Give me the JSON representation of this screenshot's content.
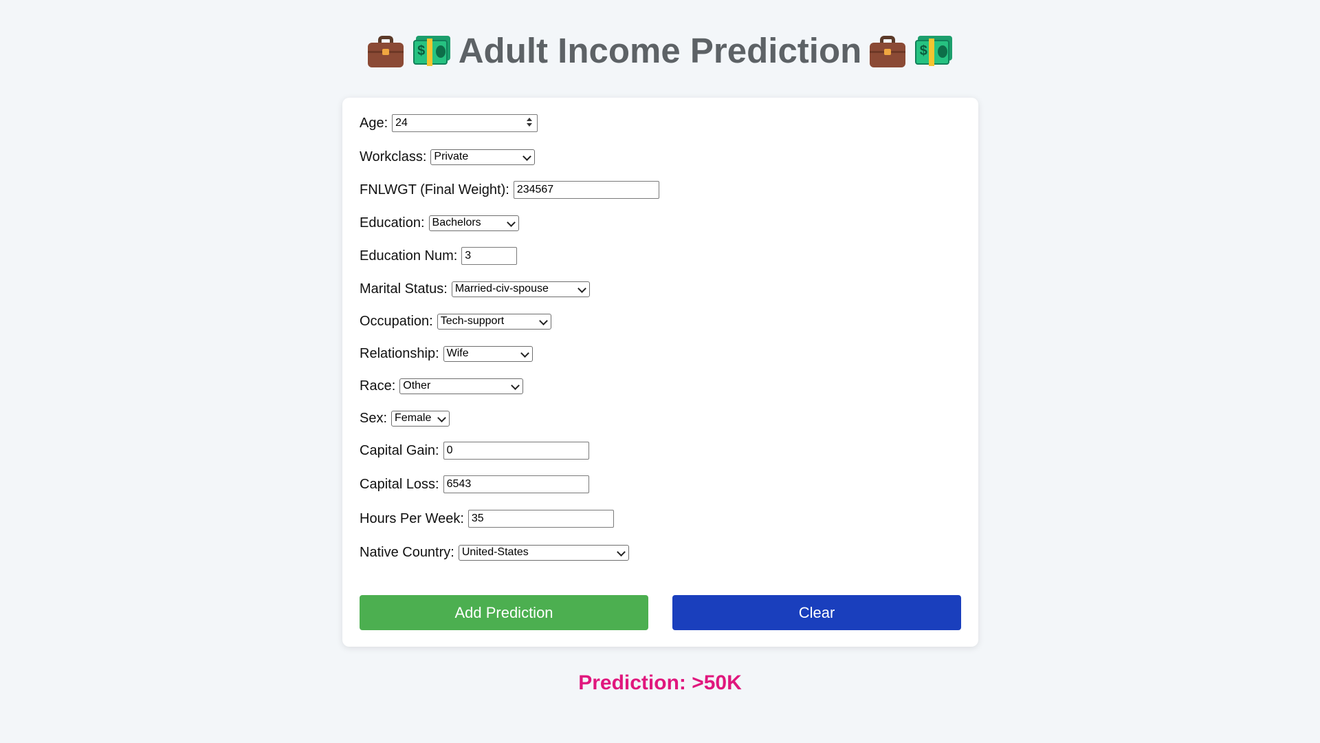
{
  "header": {
    "title": "Adult Income Prediction",
    "left_icons": [
      "briefcase-icon",
      "money-icon"
    ],
    "right_icons": [
      "briefcase-icon",
      "money-icon"
    ]
  },
  "form": {
    "age": {
      "label": "Age:",
      "value": "24"
    },
    "workclass": {
      "label": "Workclass:",
      "value": "Private"
    },
    "fnlwgt": {
      "label": "FNLWGT (Final Weight):",
      "value": "234567"
    },
    "education": {
      "label": "Education:",
      "value": "Bachelors"
    },
    "education_num": {
      "label": "Education Num:",
      "value": "3"
    },
    "marital_status": {
      "label": "Marital Status:",
      "value": "Married-civ-spouse"
    },
    "occupation": {
      "label": "Occupation:",
      "value": "Tech-support"
    },
    "relationship": {
      "label": "Relationship:",
      "value": "Wife"
    },
    "race": {
      "label": "Race:",
      "value": "Other"
    },
    "sex": {
      "label": "Sex:",
      "value": "Female"
    },
    "capital_gain": {
      "label": "Capital Gain:",
      "value": "0"
    },
    "capital_loss": {
      "label": "Capital Loss:",
      "value": "6543"
    },
    "hours_per_week": {
      "label": "Hours Per Week:",
      "value": "35"
    },
    "native_country": {
      "label": "Native Country:",
      "value": "United-States"
    }
  },
  "buttons": {
    "add_label": "Add Prediction",
    "clear_label": "Clear"
  },
  "result": {
    "text": "Prediction: >50K"
  },
  "colors": {
    "background": "#f3f6f9",
    "title": "#5d6266",
    "add_button": "#4caf50",
    "clear_button": "#1a3fbd",
    "prediction": "#e0177d"
  }
}
